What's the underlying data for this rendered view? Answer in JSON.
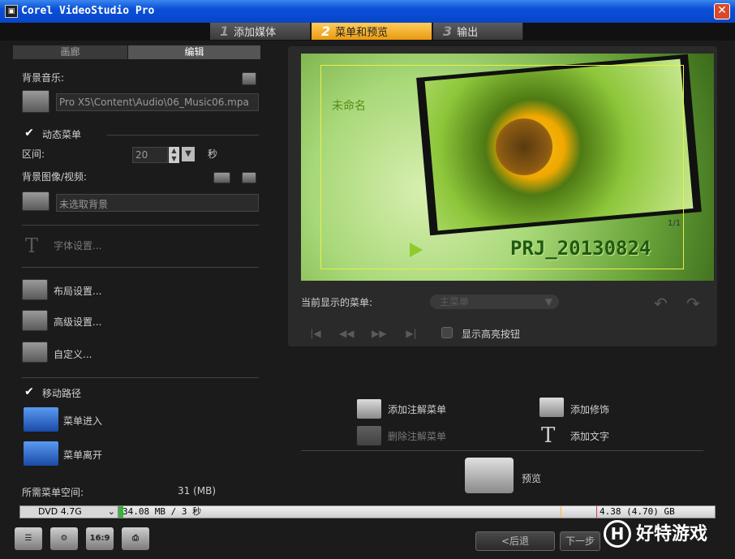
{
  "window": {
    "title": "Corel VideoStudio Pro",
    "close_glyph": "✕"
  },
  "steps": [
    {
      "num": "1",
      "label": "添加媒体"
    },
    {
      "num": "2",
      "label": "菜单和预览"
    },
    {
      "num": "3",
      "label": "输出"
    }
  ],
  "left_tabs": {
    "gallery": "画廊",
    "edit": "编辑"
  },
  "bg_music": {
    "label": "背景音乐:",
    "path": "Pro X5\\Content\\Audio\\06_Music06.mpa"
  },
  "motion_menu": {
    "label": "动态菜单",
    "checked": true
  },
  "duration": {
    "label": "区间:",
    "value": "20",
    "unit": "秒"
  },
  "bg_image": {
    "label": "背景图像/视频:",
    "value": "未选取背景"
  },
  "font_settings": "字体设置...",
  "layout_settings": "布局设置...",
  "advanced_settings": "高级设置...",
  "customize": "自定义...",
  "motion_path": {
    "label": "移动路径",
    "checked": true
  },
  "menu_in": "菜单进入",
  "menu_out": "菜单离开",
  "space": {
    "label": "所需菜单空间:",
    "value": "31 (MB)"
  },
  "preview": {
    "menu_title": "未命名",
    "project_title": "PRJ_20130824",
    "page": "1/1"
  },
  "current_menu": {
    "label": "当前显示的菜单:",
    "value": "主菜单"
  },
  "show_highlight": "显示高亮按钮",
  "actions": {
    "add_note_menu": "添加注解菜单",
    "delete_note_menu": "删除注解菜单",
    "add_decoration": "添加修饰",
    "add_text": "添加文字",
    "preview": "预览"
  },
  "disc": {
    "type": "DVD 4.7G",
    "used": "34.08 MB / 3 秒",
    "capacity": "4.38 (4.70) GB",
    "used_fraction": 0.007
  },
  "nav": {
    "back": "<后退",
    "next": "下一步"
  },
  "bottom_icons": {
    "aspect": "16:9"
  },
  "watermark": {
    "letter": "H",
    "text": "好特游戏"
  },
  "colors": {
    "active_step": "#f0a820",
    "title_bar": "#0a4fd8",
    "progress": "#2dbb2d"
  }
}
